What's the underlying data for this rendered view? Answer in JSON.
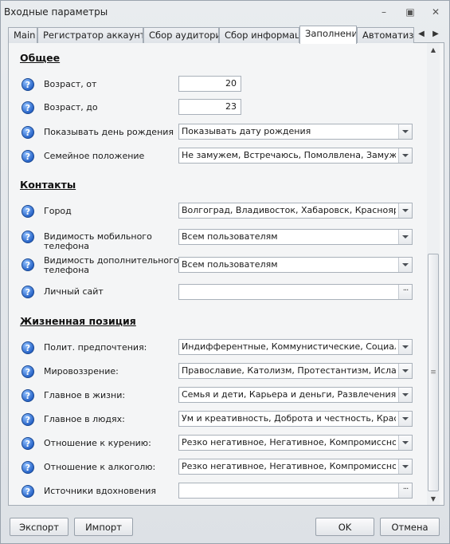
{
  "window": {
    "title": "Входные параметры",
    "minimize_glyph": "–",
    "restore_glyph": "▣",
    "close_glyph": "✕"
  },
  "tabs": [
    {
      "label": "Main"
    },
    {
      "label": "Регистратор аккаунтов"
    },
    {
      "label": "Сбор аудитории"
    },
    {
      "label": "Сбор информации"
    },
    {
      "label": "Заполнение",
      "active": true
    },
    {
      "label": "Автоматизац"
    }
  ],
  "sections": {
    "general": "Общее",
    "contacts": "Контакты",
    "life_position": "Жизненная позиция"
  },
  "fields": {
    "age_from": {
      "label": "Возраст, от",
      "value": "20"
    },
    "age_to": {
      "label": "Возраст, до",
      "value": "23"
    },
    "show_birthday": {
      "label": "Показывать день рождения",
      "value": "Показывать дату рождения"
    },
    "marital_status": {
      "label": "Семейное положение",
      "value": "Не замужем, Встречаюсь, Помолвлена, Замужем, В..."
    },
    "city": {
      "label": "Город",
      "value": "Волгоград, Владивосток, Хабаровск, Красноярск, ..."
    },
    "mobile_visibility": {
      "label_line1": "Видимость мобильного",
      "label_line2": "телефона",
      "value": "Всем пользователям"
    },
    "extra_phone_visibility": {
      "label_line1": "Видимость дополнительного",
      "label_line2": "телефона",
      "value": "Всем пользователям"
    },
    "personal_site": {
      "label": "Личный сайт",
      "value": ""
    },
    "political": {
      "label": "Полит. предпочтения:",
      "value": "Индифферентные, Коммунистические, Социалист..."
    },
    "worldview": {
      "label": "Мировоззрение:",
      "value": "Православие, Католизм, Протестантизм, Ислам, Б..."
    },
    "main_in_life": {
      "label": "Главное в жизни:",
      "value": "Семья и дети, Карьера и деньги, Развлечения и о..."
    },
    "main_in_people": {
      "label": "Главное в людях:",
      "value": "Ум и креативность, Доброта и честность, Красота..."
    },
    "smoking": {
      "label": "Отношение к курению:",
      "value": "Резко негативное, Негативное, Компромиссное, Н..."
    },
    "alcohol": {
      "label": "Отношение к алкоголю:",
      "value": "Резко негативное, Негативное, Компромиссное, Н..."
    },
    "inspiration": {
      "label": "Источники вдохновения",
      "value": ""
    }
  },
  "footer": {
    "export": "Экспорт",
    "import": "Импорт",
    "ok": "OK",
    "cancel": "Отмена"
  },
  "colors": {
    "help_icon": "#2a66c9",
    "background": "#f4f5f6"
  }
}
